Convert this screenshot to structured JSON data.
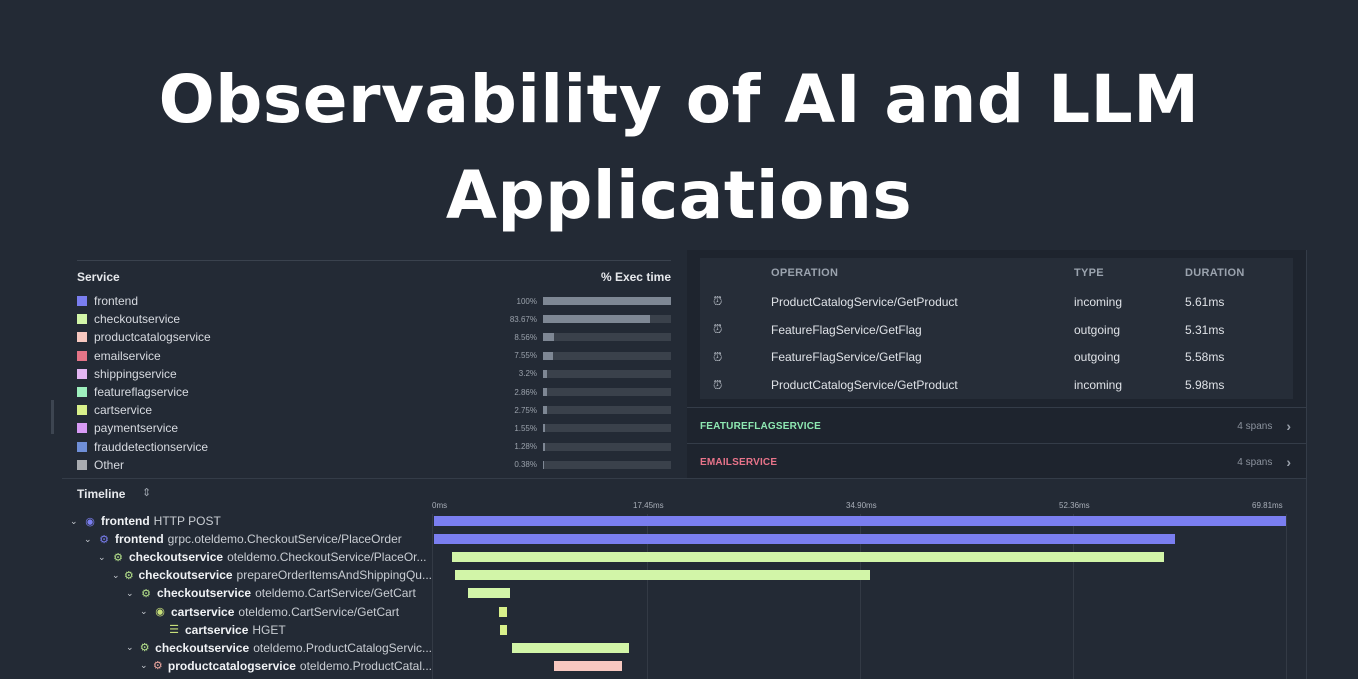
{
  "hero": {
    "line1": "Observability of AI and LLM",
    "line2": "Applications"
  },
  "service_panel": {
    "header_service": "Service",
    "header_exec": "% Exec time",
    "services": [
      {
        "name": "frontend",
        "pct_label": "100%",
        "pct": 100,
        "color": "#7a7ef0"
      },
      {
        "name": "checkoutservice",
        "pct_label": "83.67%",
        "pct": 83.67,
        "color": "#d2f5a8"
      },
      {
        "name": "productcatalogservice",
        "pct_label": "8.56%",
        "pct": 8.56,
        "color": "#f7c8c0"
      },
      {
        "name": "emailservice",
        "pct_label": "7.55%",
        "pct": 7.55,
        "color": "#e57487"
      },
      {
        "name": "shippingservice",
        "pct_label": "3.2%",
        "pct": 3.2,
        "color": "#e3b6f2"
      },
      {
        "name": "featureflagservice",
        "pct_label": "2.86%",
        "pct": 2.86,
        "color": "#9ef0be"
      },
      {
        "name": "cartservice",
        "pct_label": "2.75%",
        "pct": 2.75,
        "color": "#d8f08a"
      },
      {
        "name": "paymentservice",
        "pct_label": "1.55%",
        "pct": 1.55,
        "color": "#d79af5"
      },
      {
        "name": "frauddetectionservice",
        "pct_label": "1.28%",
        "pct": 1.28,
        "color": "#6f8fd8"
      },
      {
        "name": "Other",
        "pct_label": "0.38%",
        "pct": 0.38,
        "color": "#a9acb1"
      }
    ]
  },
  "operations": {
    "headers": {
      "operation": "OPERATION",
      "type": "TYPE",
      "duration": "DURATION"
    },
    "icon": "alarm-clock-icon",
    "rows": [
      {
        "operation": "ProductCatalogService/GetProduct",
        "type": "incoming",
        "duration": "5.61ms"
      },
      {
        "operation": "FeatureFlagService/GetFlag",
        "type": "outgoing",
        "duration": "5.31ms"
      },
      {
        "operation": "FeatureFlagService/GetFlag",
        "type": "outgoing",
        "duration": "5.58ms"
      },
      {
        "operation": "ProductCatalogService/GetProduct",
        "type": "incoming",
        "duration": "5.98ms"
      }
    ],
    "groups": [
      {
        "name": "FEATUREFLAGSERVICE",
        "count": "4 spans",
        "color": "#8ee8b2"
      },
      {
        "name": "EMAILSERVICE",
        "count": "4 spans",
        "color": "#e8748a"
      }
    ]
  },
  "timeline": {
    "title": "Timeline",
    "ticks": [
      "0ms",
      "17.45ms",
      "34.90ms",
      "52.36ms",
      "69.81ms"
    ],
    "total_ms": 69.81,
    "rows": [
      {
        "depth": 0,
        "service": "frontend",
        "op": "HTTP POST",
        "icon": "globe-icon",
        "start_ms": 0,
        "dur_ms": 69.81,
        "color": "#7a7ef0"
      },
      {
        "depth": 1,
        "service": "frontend",
        "op": "grpc.oteldemo.CheckoutService/PlaceOrder",
        "icon": "gear-icon",
        "start_ms": 0,
        "dur_ms": 60.7,
        "color": "#7a7ef0"
      },
      {
        "depth": 2,
        "service": "checkoutservice",
        "op": "oteldemo.CheckoutService/PlaceOr...",
        "icon": "gear-icon",
        "start_ms": 1.5,
        "dur_ms": 58.3,
        "color": "#d2f5a8"
      },
      {
        "depth": 3,
        "service": "checkoutservice",
        "op": "prepareOrderItemsAndShippingQu...",
        "icon": "gear-icon",
        "start_ms": 1.7,
        "dur_ms": 34.0,
        "color": "#d2f5a8"
      },
      {
        "depth": 4,
        "service": "checkoutservice",
        "op": "oteldemo.CartService/GetCart",
        "icon": "gear-icon",
        "start_ms": 2.8,
        "dur_ms": 3.4,
        "color": "#d2f5a8"
      },
      {
        "depth": 5,
        "service": "cartservice",
        "op": "oteldemo.CartService/GetCart",
        "icon": "globe-icon",
        "start_ms": 5.3,
        "dur_ms": 0.7,
        "color": "#d8f08a"
      },
      {
        "depth": 6,
        "service": "cartservice",
        "op": "HGET",
        "icon": "database-icon",
        "start_ms": 5.4,
        "dur_ms": 0.6,
        "color": "#d8f08a"
      },
      {
        "depth": 4,
        "service": "checkoutservice",
        "op": "oteldemo.ProductCatalogServic...",
        "icon": "gear-icon",
        "start_ms": 6.4,
        "dur_ms": 9.6,
        "color": "#d2f5a8"
      },
      {
        "depth": 5,
        "service": "productcatalogservice",
        "op": "oteldemo.ProductCatal...",
        "icon": "gear-icon",
        "start_ms": 9.8,
        "dur_ms": 5.6,
        "color": "#f7c8c0"
      }
    ]
  }
}
